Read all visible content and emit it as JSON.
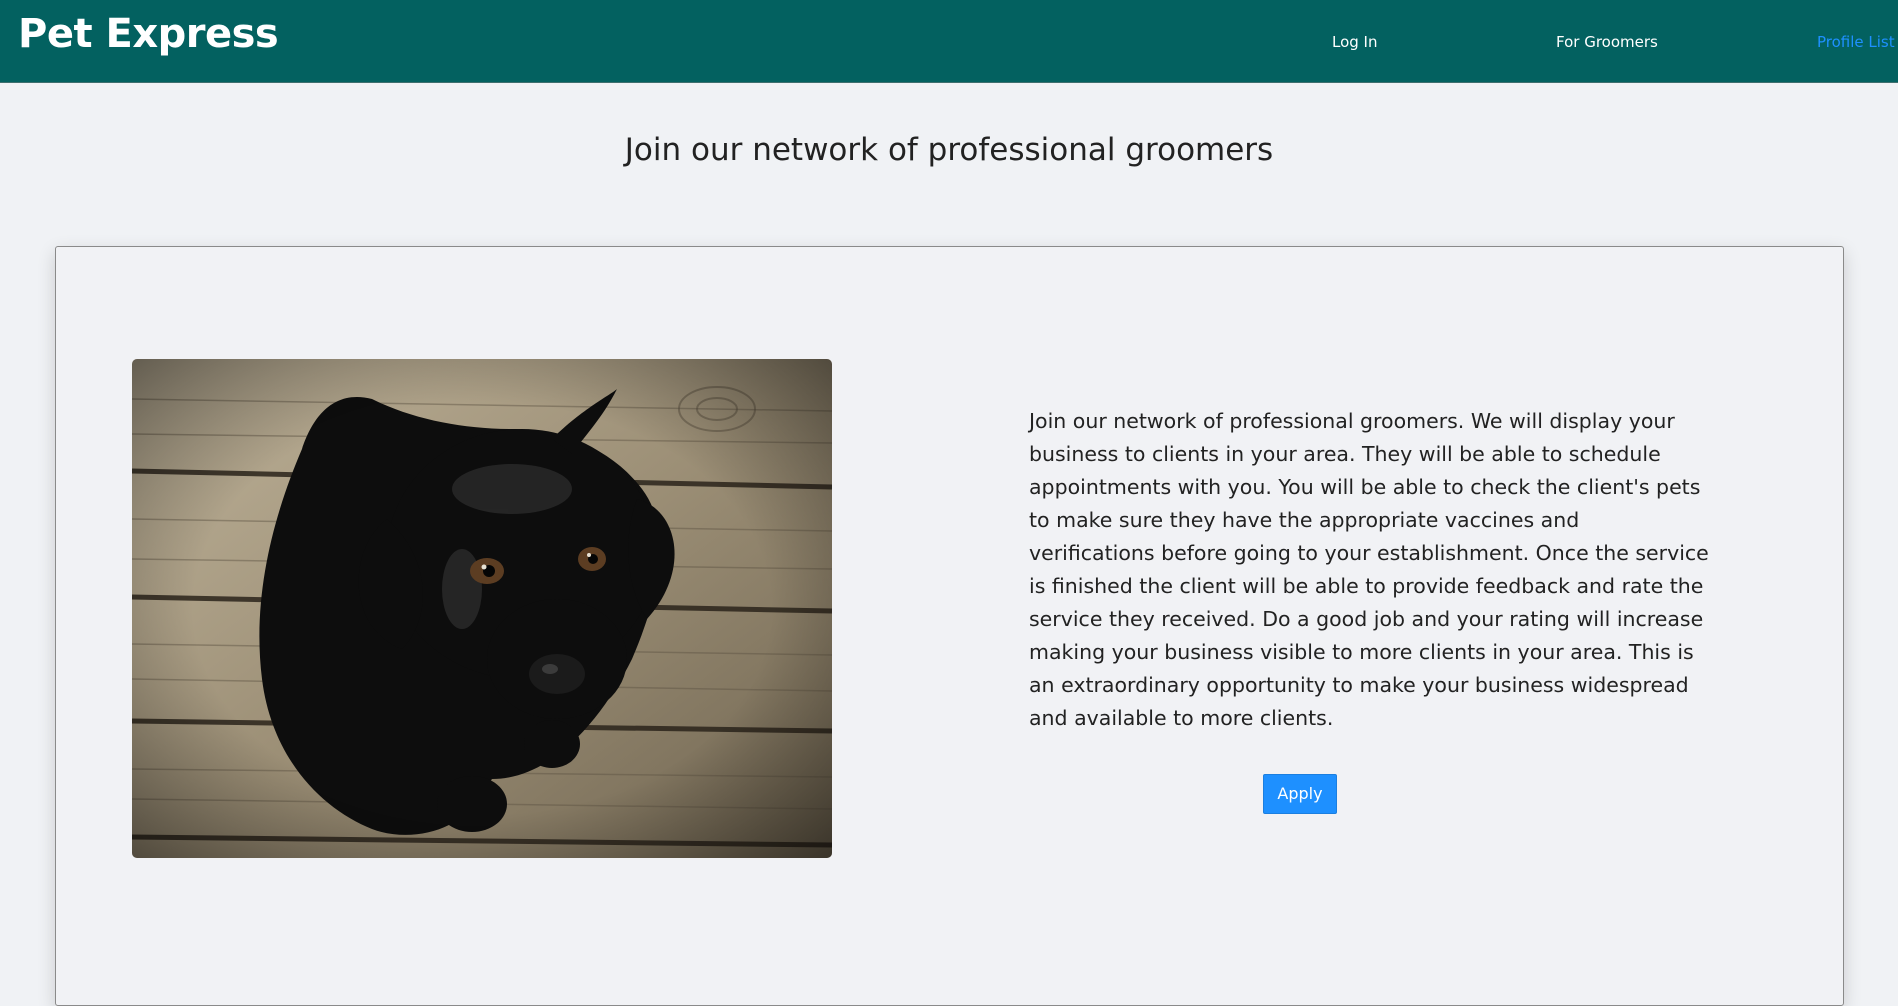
{
  "header": {
    "brand": "Pet Express",
    "nav": {
      "login": "Log In",
      "for_groomers": "For Groomers",
      "profile_list": "Profile List"
    }
  },
  "main": {
    "title": "Join our network of professional groomers",
    "description": "Join our network of professional groomers. We will display your business to clients in your area. They will be able to schedule appointments with you. You will be able to check the client's pets to make sure they have the appropriate vaccines and verifications before going to your establishment. Once the service is finished the client will be able to provide feedback and rate the service they received. Do a good job and your rating will increase making your business visible to more clients in your area. This is an extraordinary opportunity to make your business widespread and available to more clients.",
    "apply_label": "Apply"
  },
  "colors": {
    "navbar": "#036160",
    "accent": "#1e90ff",
    "page_background": "#f0f2f5"
  }
}
